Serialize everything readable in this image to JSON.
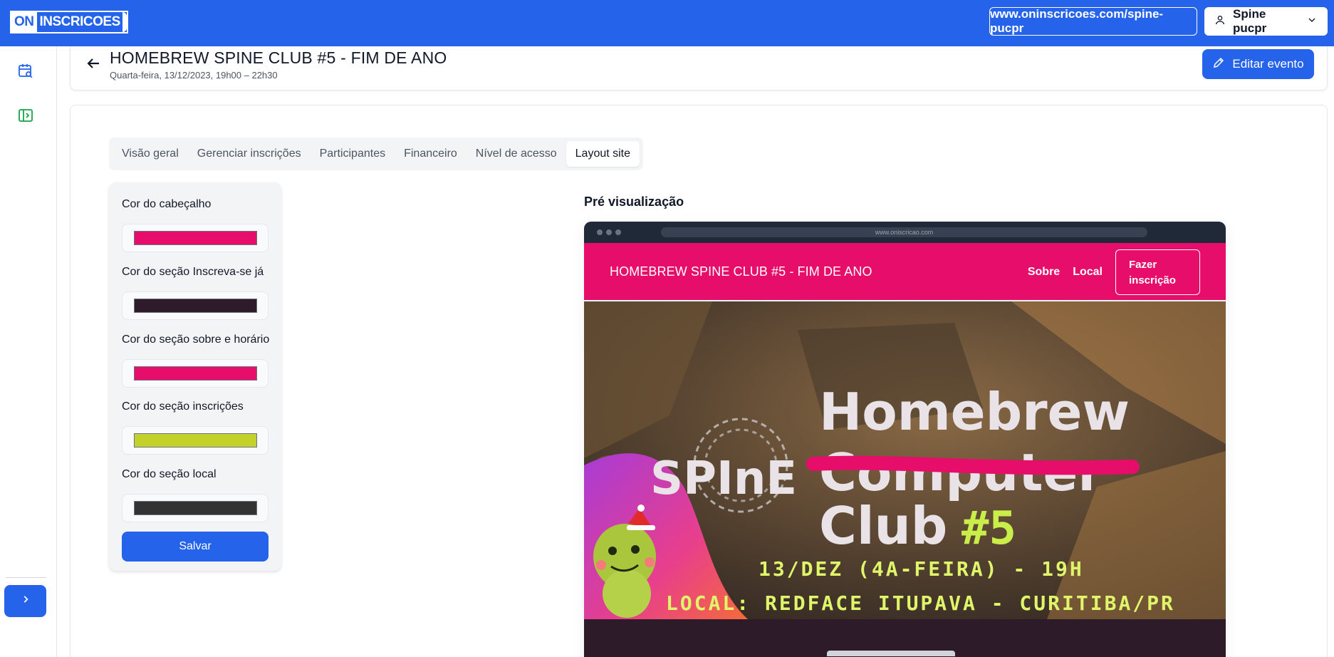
{
  "app": {
    "logo_on": "ON",
    "logo_rest": "INSCRICOES",
    "site_url": "www.oninscricoes.com/spine-pucpr",
    "user_name": "Spine pucpr"
  },
  "rail": {
    "icons": [
      "calendar-search-icon",
      "panel-expand-icon"
    ],
    "expand_icon": "chevron-right-icon"
  },
  "event": {
    "title": "HOMEBREW SPINE CLUB #5 - FIM DE ANO",
    "subtitle": "Quarta-feira, 13/12/2023, 19h00 – 22h30",
    "edit_label": "Editar evento"
  },
  "tabs": [
    {
      "label": "Visão geral",
      "active": false
    },
    {
      "label": "Gerenciar inscrições",
      "active": false
    },
    {
      "label": "Participantes",
      "active": false
    },
    {
      "label": "Financeiro",
      "active": false
    },
    {
      "label": "Nível de acesso",
      "active": false
    },
    {
      "label": "Layout site",
      "active": true
    }
  ],
  "colors": {
    "fields": [
      {
        "label": "Cor do cabeçalho",
        "value": "#e70e6b"
      },
      {
        "label": "Cor do seção Inscreva-se já",
        "value": "#2d1b2a"
      },
      {
        "label": "Cor do seção sobre e horário",
        "value": "#e70e6b"
      },
      {
        "label": "Cor do seção inscrições",
        "value": "#c4d12b"
      },
      {
        "label": "Cor do seção local",
        "value": "#333333"
      }
    ],
    "save_label": "Salvar"
  },
  "preview": {
    "label": "Pré visualização",
    "address": "www.oniscricao.com",
    "site_title": "HOMEBREW SPINE CLUB #5 - FIM DE ANO",
    "nav_about": "Sobre",
    "nav_location": "Local",
    "cta": "Fazer inscrição",
    "banner": {
      "line1": "Homebrew",
      "line2_struck": "Computer",
      "line3": "Club",
      "number": "#5",
      "brand": "SPInE",
      "date": "13/DEZ (4A-FEIRA) - 19H",
      "local": "LOCAL: REDFACE ITUPAVA - CURITIBA/PR"
    }
  },
  "theme": {
    "primary": "#2563eb",
    "header_pink": "#e70e6b",
    "dark_section": "#2d1b2a",
    "lime": "#c4d12b"
  }
}
